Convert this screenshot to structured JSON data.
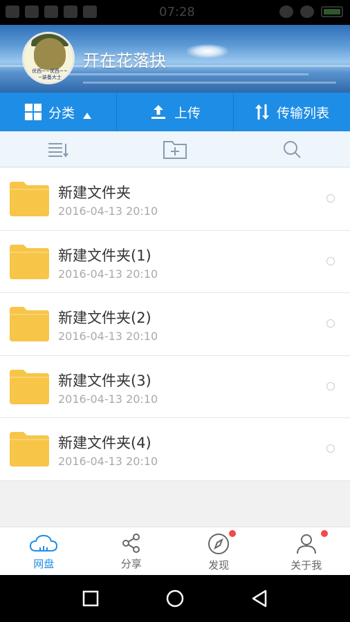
{
  "status_bar": {
    "time": "07:28"
  },
  "header": {
    "username": "开在花落抉",
    "avatar_caption": "优西~~优西~~\n装备大士"
  },
  "top_actions": [
    {
      "label": "分类",
      "icon": "grid-icon"
    },
    {
      "label": "上传",
      "icon": "upload-icon"
    },
    {
      "label": "传输列表",
      "icon": "transfer-icon"
    }
  ],
  "toolbar": [
    {
      "icon": "sort-icon"
    },
    {
      "icon": "new-folder-icon"
    },
    {
      "icon": "search-icon"
    }
  ],
  "files": [
    {
      "name": "新建文件夹",
      "date": "2016-04-13  20:10"
    },
    {
      "name": "新建文件夹(1)",
      "date": "2016-04-13  20:10"
    },
    {
      "name": "新建文件夹(2)",
      "date": "2016-04-13  20:10"
    },
    {
      "name": "新建文件夹(3)",
      "date": "2016-04-13  20:10"
    },
    {
      "name": "新建文件夹(4)",
      "date": "2016-04-13  20:10"
    }
  ],
  "bottom_nav": [
    {
      "label": "网盘",
      "icon": "cloud-icon",
      "active": true,
      "badge": false
    },
    {
      "label": "分享",
      "icon": "share-icon",
      "active": false,
      "badge": false
    },
    {
      "label": "发现",
      "icon": "compass-icon",
      "active": false,
      "badge": true
    },
    {
      "label": "关于我",
      "icon": "user-icon",
      "active": false,
      "badge": true
    }
  ],
  "colors": {
    "accent": "#1e8de6",
    "folder": "#f7c548",
    "badge": "#f2494a"
  }
}
